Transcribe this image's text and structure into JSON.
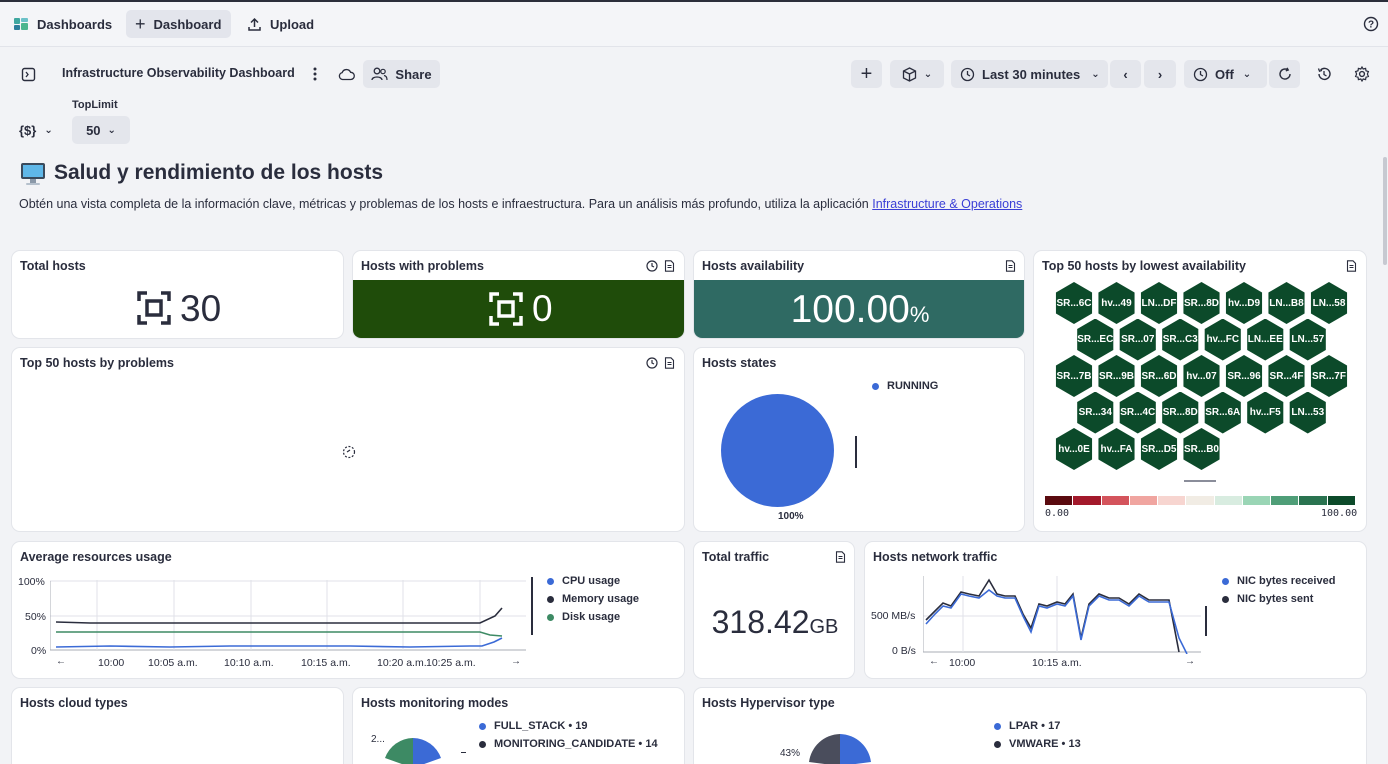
{
  "topbar": {
    "dashboards_label": "Dashboards",
    "dashboard_label": "Dashboard",
    "upload_label": "Upload"
  },
  "toolbar": {
    "dashboard_name": "Infrastructure Observability Dashboard",
    "share_label": "Share",
    "timeframe_label": "Last 30 minutes",
    "refresh_label": "Off"
  },
  "variables": {
    "var_icon_label": "{$}",
    "toplimit_label": "TopLimit",
    "toplimit_value": "50"
  },
  "header": {
    "title": "Salud y rendimiento de los hosts",
    "description": "Obtén una vista completa de la información clave, métricas y problemas de los hosts e infraestructura. Para un análisis más profundo, utiliza la aplicación ",
    "link": "Infrastructure & Operations"
  },
  "tiles": {
    "total_hosts": {
      "title": "Total hosts",
      "value": "30"
    },
    "hosts_with_problems": {
      "title": "Hosts with problems",
      "value": "0",
      "color": "#1f4c0a"
    },
    "hosts_availability": {
      "title": "Hosts availability",
      "value": "100.00",
      "unit": "%",
      "color": "#2f6a63"
    },
    "lowest_availability": {
      "title": "Top 50 hosts by lowest availability",
      "hexes": [
        [
          "SR...6C",
          "hv...49",
          "LN...DF",
          "SR...8D",
          "hv...D9",
          "LN...B8",
          "LN...58"
        ],
        [
          "SR...EC",
          "SR...07",
          "SR...C3",
          "hv...FC",
          "LN...EE",
          "LN...57"
        ],
        [
          "SR...7B",
          "SR...9B",
          "SR...6D",
          "hv...07",
          "SR...96",
          "SR...4F",
          "SR...7F"
        ],
        [
          "SR...34",
          "SR...4C",
          "SR...8D",
          "SR...6A",
          "hv...F5",
          "LN...53"
        ],
        [
          "hv...0E",
          "hv...FA",
          "SR...D5",
          "SR...B0"
        ]
      ],
      "scale_min": "0.00",
      "scale_max": "100.00",
      "scale_colors": [
        "#5a0a0f",
        "#a3192b",
        "#d4545c",
        "#f0a5a0",
        "#f7d5d0",
        "#f1ece4",
        "#d8ece0",
        "#9ad5b5",
        "#4f9e78",
        "#2a7350",
        "#0c4a2a"
      ]
    },
    "top_by_problems": {
      "title": "Top 50 hosts by problems"
    },
    "hosts_states": {
      "title": "Hosts states",
      "legend": "RUNNING",
      "percent_label": "100%",
      "color": "#3b6ad6"
    },
    "avg_resources": {
      "title": "Average resources usage",
      "legend": [
        {
          "name": "CPU usage",
          "color": "#3b6ad6"
        },
        {
          "name": "Memory usage",
          "color": "#2a2d3d"
        },
        {
          "name": "Disk usage",
          "color": "#3d8a64"
        }
      ],
      "y_ticks": [
        "100%",
        "50%",
        "0%"
      ],
      "x_ticks": [
        "10:00",
        "10:05 a.m.",
        "10:10 a.m.",
        "10:15 a.m.",
        "10:20 a.m.",
        "10:25 a.m."
      ]
    },
    "total_traffic": {
      "title": "Total traffic",
      "value": "318.42",
      "unit": "GB"
    },
    "network_traffic": {
      "title": "Hosts network traffic",
      "legend": [
        {
          "name": "NIC bytes received",
          "color": "#3b6ad6"
        },
        {
          "name": "NIC bytes sent",
          "color": "#2a2d3d"
        }
      ],
      "y_ticks": [
        "500 MB/s",
        "0 B/s"
      ],
      "x_ticks": [
        "10:00",
        "10:15 a.m."
      ]
    },
    "cloud_types": {
      "title": "Hosts cloud types"
    },
    "monitoring_modes": {
      "title": "Hosts monitoring modes",
      "legend": [
        "FULL_STACK • 19",
        "MONITORING_CANDIDATE • 14"
      ],
      "pie_label": "2..."
    },
    "hypervisor_type": {
      "title": "Hosts Hypervisor type",
      "legend": [
        "LPAR • 17",
        "VMWARE • 13"
      ],
      "pie_label": "43%"
    }
  }
}
